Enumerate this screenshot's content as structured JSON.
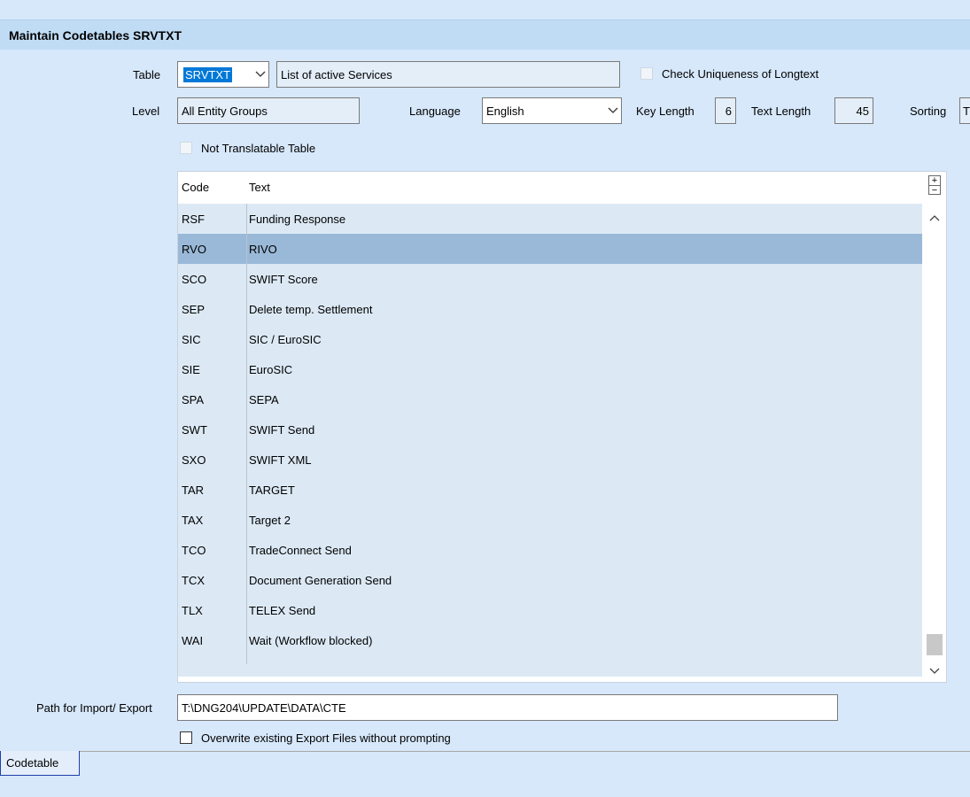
{
  "window_title": "Maintain Codetables SRVTXT",
  "form": {
    "table_label": "Table",
    "table_value": "SRVTXT",
    "table_description": "List of active Services",
    "check_uniqueness_label": "Check Uniqueness of Longtext",
    "level_label": "Level",
    "level_value": "All Entity Groups",
    "language_label": "Language",
    "language_value": "English",
    "key_length_label": "Key Length",
    "key_length_value": "6",
    "text_length_label": "Text Length",
    "text_length_value": "45",
    "sorting_label": "Sorting",
    "sorting_value": "T",
    "not_translatable_label": "Not Translatable Table"
  },
  "grid": {
    "columns": [
      "Code",
      "Text"
    ],
    "rows": [
      {
        "code": "RSF",
        "text": "Funding Response"
      },
      {
        "code": "RVO",
        "text": "RIVO",
        "selected": true
      },
      {
        "code": "SCO",
        "text": "SWIFT Score"
      },
      {
        "code": "SEP",
        "text": "Delete temp. Settlement"
      },
      {
        "code": "SIC",
        "text": "SIC / EuroSIC"
      },
      {
        "code": "SIE",
        "text": "EuroSIC"
      },
      {
        "code": "SPA",
        "text": "SEPA"
      },
      {
        "code": "SWT",
        "text": "SWIFT Send"
      },
      {
        "code": "SXO",
        "text": "SWIFT XML"
      },
      {
        "code": "TAR",
        "text": "TARGET"
      },
      {
        "code": "TAX",
        "text": "Target 2"
      },
      {
        "code": "TCO",
        "text": "TradeConnect Send"
      },
      {
        "code": "TCX",
        "text": "Document Generation Send"
      },
      {
        "code": "TLX",
        "text": "TELEX Send"
      },
      {
        "code": "WAI",
        "text": "Wait (Workflow blocked)"
      }
    ],
    "plus": "+",
    "minus": "−"
  },
  "path_label": "Path for Import/ Export",
  "path_value": "T:\\DNG204\\UPDATE\\DATA\\CTE",
  "overwrite_label": "Overwrite existing Export Files without prompting",
  "tab_label": "Codetable",
  "icons": {
    "dropdown": "chevron-down-icon",
    "scroll_up": "chevron-up-icon",
    "scroll_down": "chevron-down-icon"
  }
}
